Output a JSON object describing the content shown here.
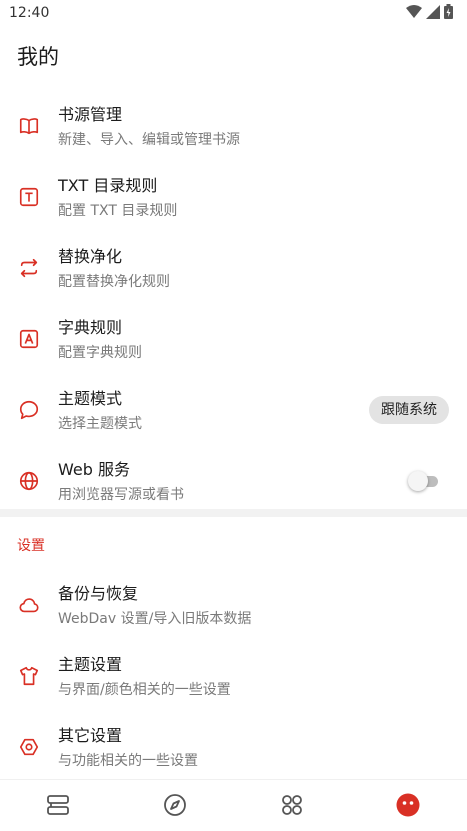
{
  "status_bar": {
    "time": "12:40"
  },
  "header": {
    "title": "我的"
  },
  "menu_items": [
    {
      "title": "书源管理",
      "subtitle": "新建、导入、编辑或管理书源",
      "icon": "book-open-icon"
    },
    {
      "title": "TXT 目录规则",
      "subtitle": "配置 TXT 目录规则",
      "icon": "text-box-icon"
    },
    {
      "title": "替换净化",
      "subtitle": "配置替换净化规则",
      "icon": "swap-arrows-icon"
    },
    {
      "title": "字典规则",
      "subtitle": "配置字典规则",
      "icon": "dictionary-a-icon"
    },
    {
      "title": "主题模式",
      "subtitle": "选择主题模式",
      "icon": "speech-bubble-icon",
      "value": "跟随系统"
    },
    {
      "title": "Web 服务",
      "subtitle": "用浏览器写源或看书",
      "icon": "globe-icon",
      "switch_on": false
    }
  ],
  "settings_section": {
    "header": "设置",
    "items": [
      {
        "title": "备份与恢复",
        "subtitle": "WebDav 设置/导入旧版本数据",
        "icon": "cloud-icon"
      },
      {
        "title": "主题设置",
        "subtitle": "与界面/颜色相关的一些设置",
        "icon": "tshirt-icon"
      },
      {
        "title": "其它设置",
        "subtitle": "与功能相关的一些设置",
        "icon": "gear-icon"
      }
    ]
  },
  "bottom_nav": [
    {
      "name": "bookshelf",
      "icon": "bookshelf-icon",
      "active": false
    },
    {
      "name": "discover",
      "icon": "compass-icon",
      "active": false
    },
    {
      "name": "rss",
      "icon": "grid-icon",
      "active": false
    },
    {
      "name": "my",
      "icon": "face-icon",
      "active": true
    }
  ],
  "colors": {
    "accent": "#d93025",
    "icon_gray": "#555555",
    "subtitle": "#7a7a7a",
    "divider": "#f2f2f2"
  }
}
